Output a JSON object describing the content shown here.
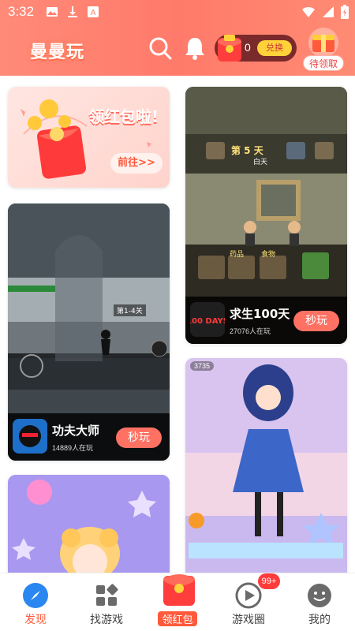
{
  "status_bar": {
    "time": "3:32"
  },
  "header": {
    "logo_text": "曼曼玩",
    "coin_count": "0",
    "exchange_label": "兑换",
    "gift_chip_label": "待领取"
  },
  "feed": {
    "promo": {
      "headline": "领红包啦!",
      "button": "前往>>"
    },
    "games": [
      {
        "name": "求生100天",
        "players": "27076人在玩",
        "play_label": "秒玩",
        "icon_text": "100 DAYS",
        "scene": {
          "day_banner": "第 5 天",
          "daytime": "白天",
          "tabs": [
            "药品",
            "食物"
          ]
        }
      },
      {
        "name": "功夫大师",
        "players": "14889人在玩",
        "play_label": "秒玩",
        "scene": {
          "level_label": "第1-4关"
        }
      },
      {
        "name": "",
        "scene": {
          "score": "3735"
        }
      },
      {
        "name": "",
        "scene": {}
      }
    ]
  },
  "bottom_nav": {
    "items": [
      {
        "label": "发现",
        "icon": "compass-icon"
      },
      {
        "label": "找游戏",
        "icon": "grid-icon"
      },
      {
        "label": "领红包",
        "icon": "red-envelope-icon"
      },
      {
        "label": "游戏圈",
        "icon": "play-circle-icon"
      },
      {
        "label": "我的",
        "icon": "smiley-icon"
      }
    ],
    "badge": "99+"
  },
  "colors": {
    "accent": "#ff5a3c",
    "header": "#ff7f6c",
    "play_button": "#ff7163"
  }
}
